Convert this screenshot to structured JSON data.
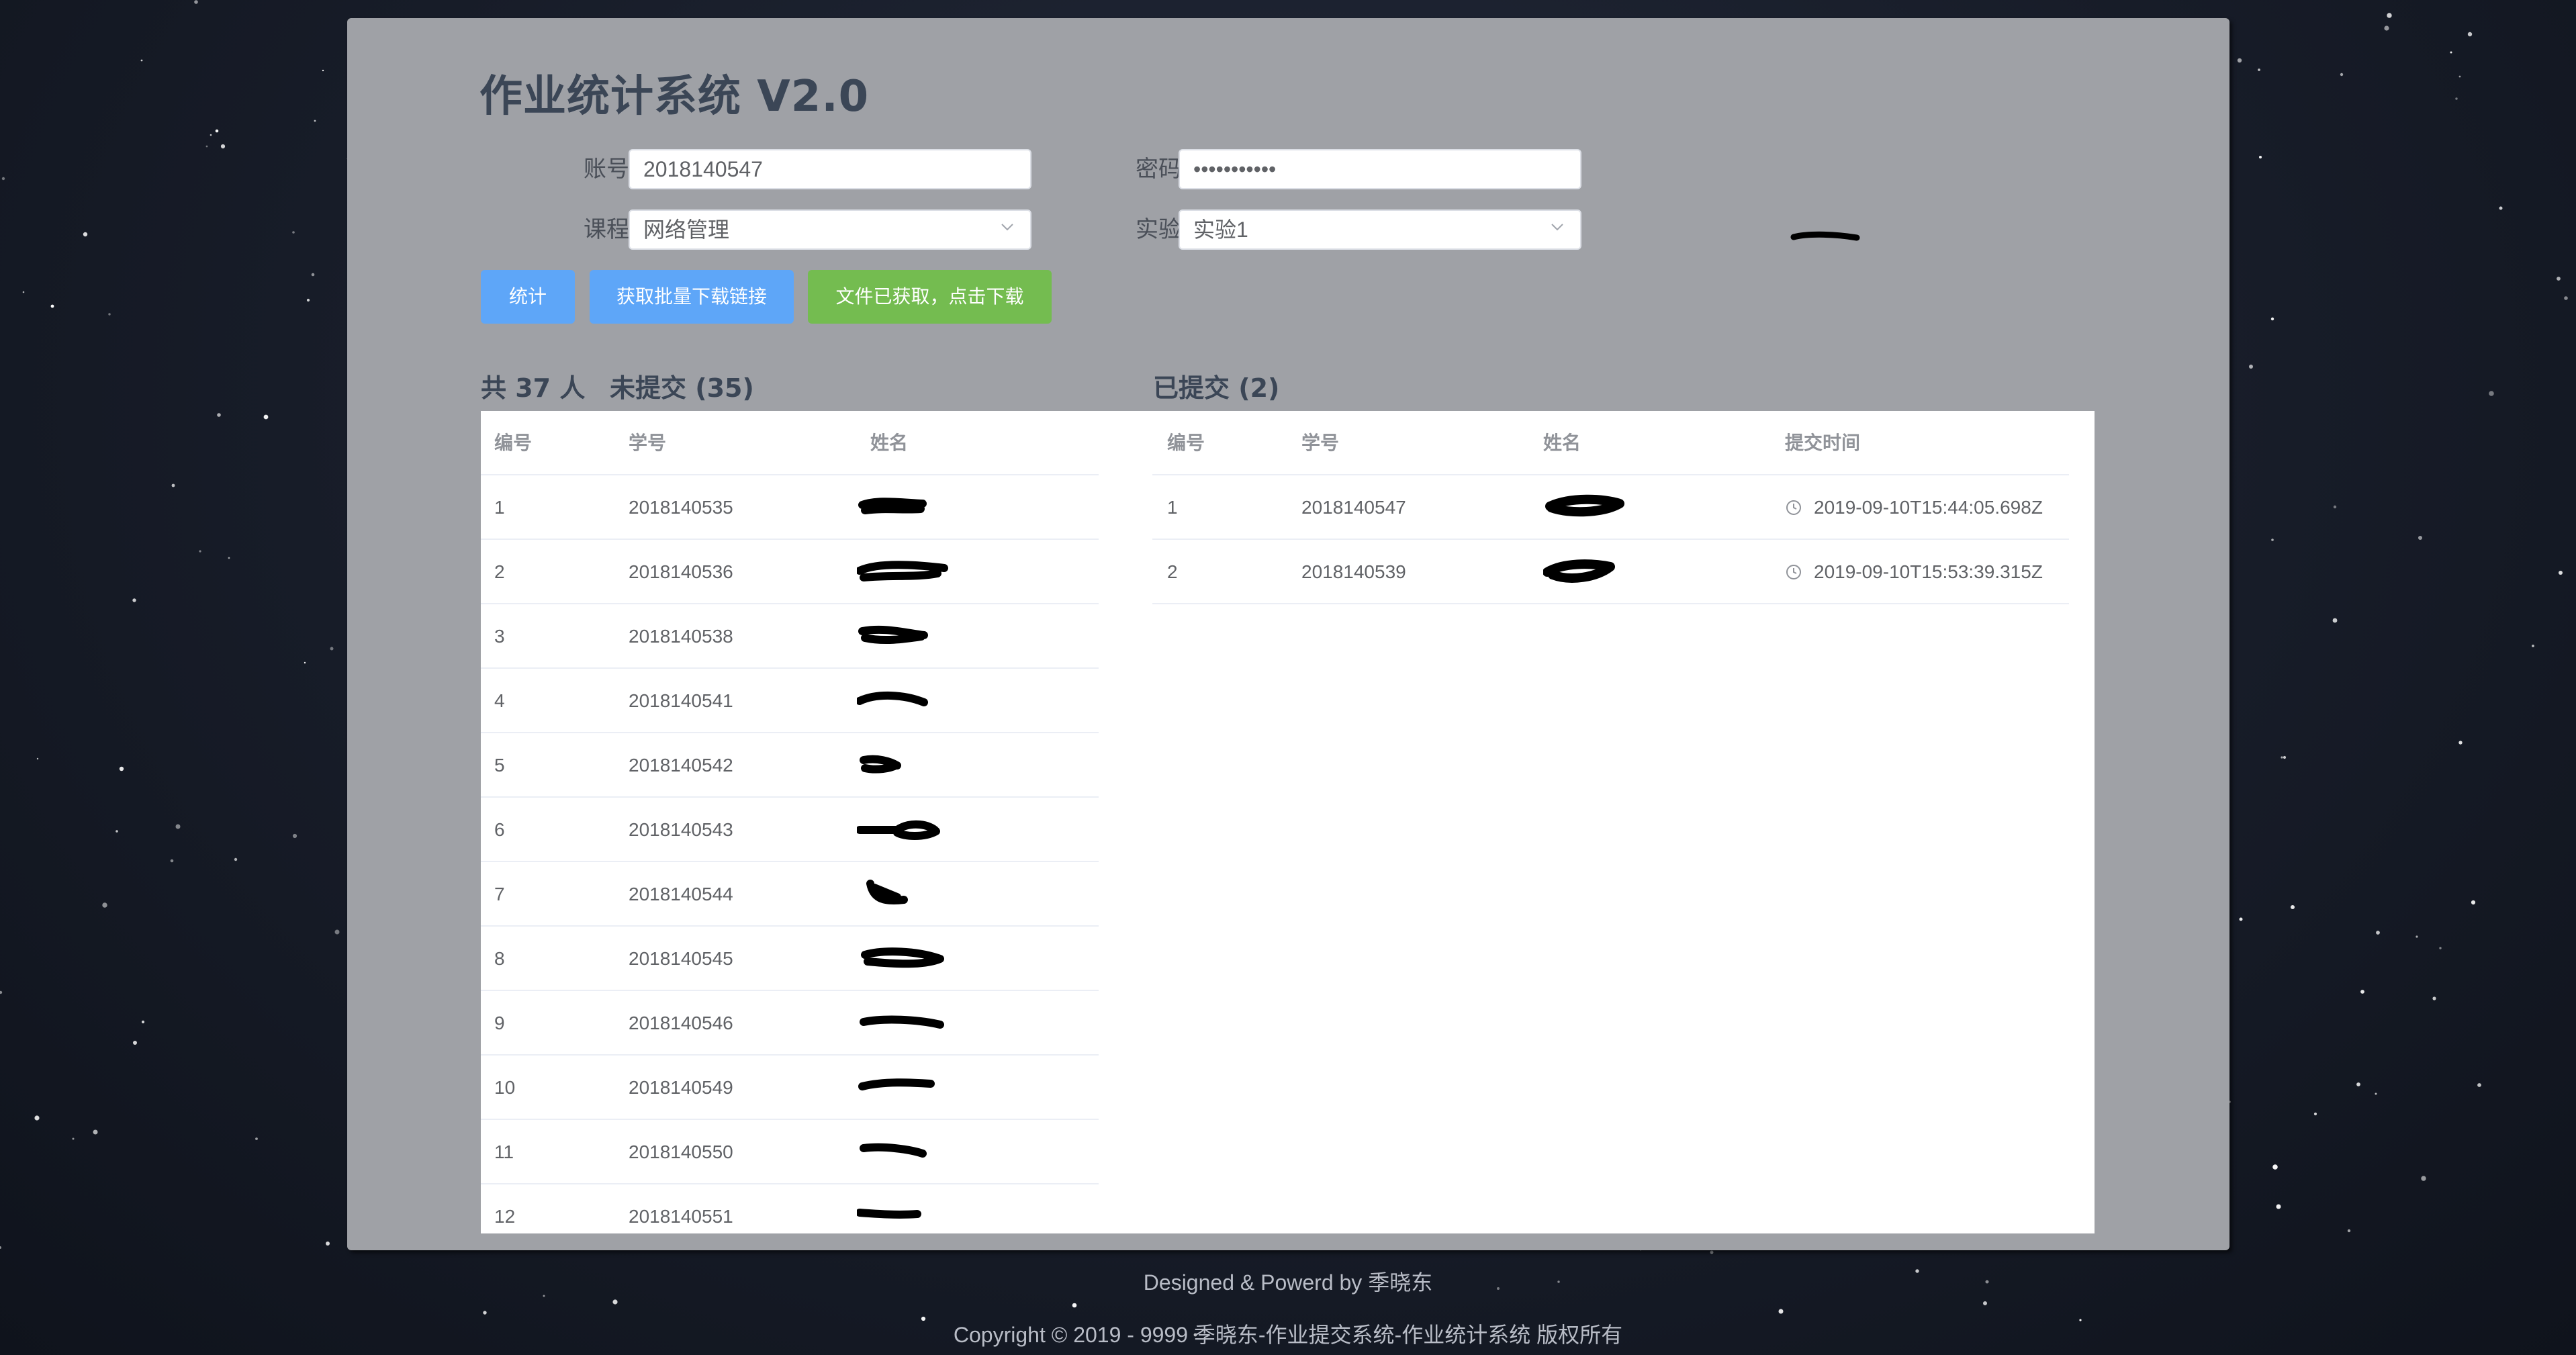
{
  "app": {
    "title": "作业统计系统 V2.0"
  },
  "form": {
    "account_label": "账号",
    "account_value": "2018140547",
    "password_label": "密码",
    "password_value": "•••••••••••",
    "course_label": "课程",
    "course_value": "网络管理",
    "experiment_label": "实验",
    "experiment_value": "实验1"
  },
  "buttons": {
    "stats": "统计",
    "batch_links": "获取批量下载链接",
    "download": "文件已获取，点击下载"
  },
  "summary": {
    "total": "共 37 人",
    "not_submitted": "未提交 (35)",
    "submitted": "已提交 (2)"
  },
  "not_submitted_table": {
    "columns": [
      "编号",
      "学号",
      "姓名"
    ],
    "rows": [
      {
        "no": "1",
        "id": "2018140535"
      },
      {
        "no": "2",
        "id": "2018140536"
      },
      {
        "no": "3",
        "id": "2018140538"
      },
      {
        "no": "4",
        "id": "2018140541"
      },
      {
        "no": "5",
        "id": "2018140542"
      },
      {
        "no": "6",
        "id": "2018140543"
      },
      {
        "no": "7",
        "id": "2018140544"
      },
      {
        "no": "8",
        "id": "2018140545"
      },
      {
        "no": "9",
        "id": "2018140546"
      },
      {
        "no": "10",
        "id": "2018140549"
      },
      {
        "no": "11",
        "id": "2018140550"
      },
      {
        "no": "12",
        "id": "2018140551"
      }
    ]
  },
  "submitted_table": {
    "columns": [
      "编号",
      "学号",
      "姓名",
      "提交时间"
    ],
    "rows": [
      {
        "no": "1",
        "id": "2018140547",
        "time": "2019-09-10T15:44:05.698Z"
      },
      {
        "no": "2",
        "id": "2018140539",
        "time": "2019-09-10T15:53:39.315Z"
      }
    ]
  },
  "footer": {
    "designed_by": "Designed & Powerd by 季晓东",
    "copyright": "Copyright © 2019 - 9999 季晓东-作业提交系统-作业统计系统 版权所有"
  },
  "colors": {
    "primary": "#5ea6f8",
    "success": "#74bc50",
    "panel": "#9fa1a6",
    "background": "#171c28"
  }
}
